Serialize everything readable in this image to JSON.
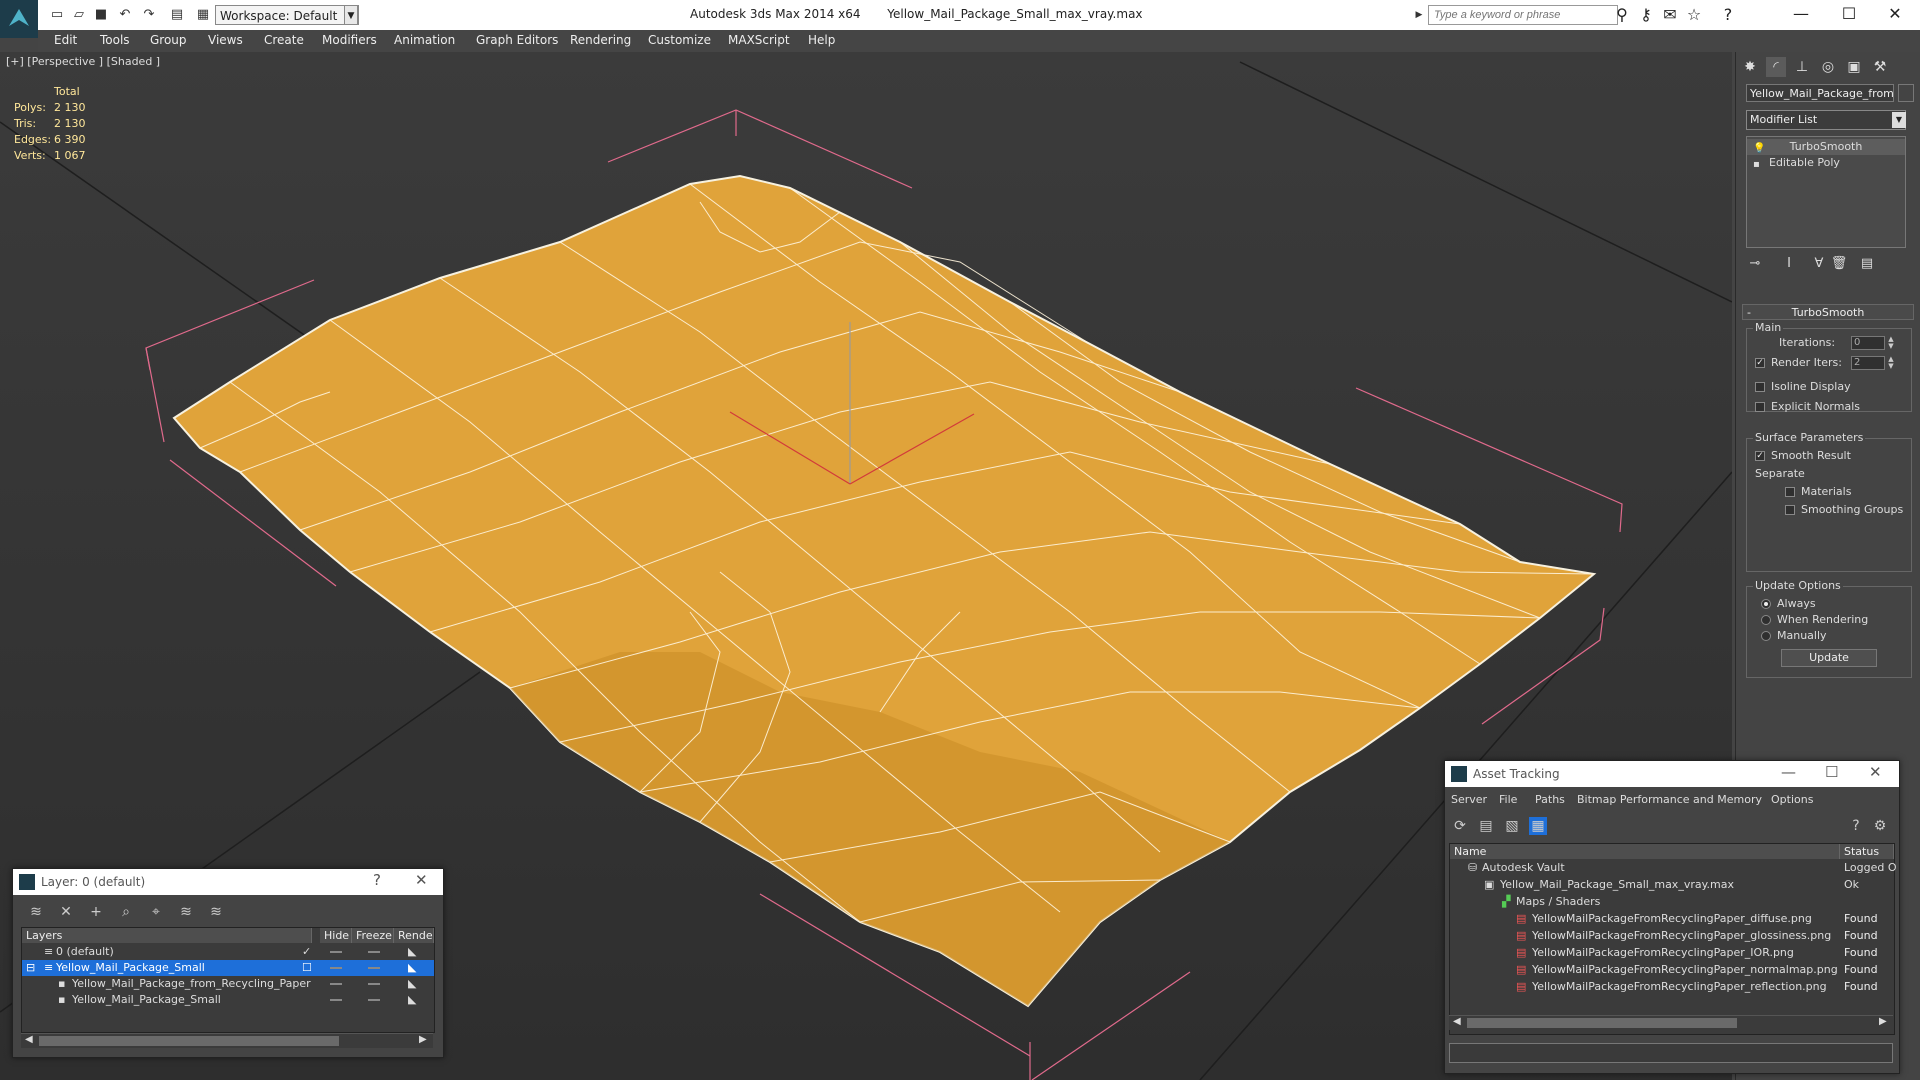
{
  "app": {
    "title": "Autodesk 3ds Max 2014 x64",
    "filename": "Yellow_Mail_Package_Small_max_vray.max",
    "workspace": "Workspace: Default",
    "search_placeholder": "Type a keyword or phrase"
  },
  "menu": [
    "Edit",
    "Tools",
    "Group",
    "Views",
    "Create",
    "Modifiers",
    "Animation",
    "Graph Editors",
    "Rendering",
    "Customize",
    "MAXScript",
    "Help"
  ],
  "viewport": {
    "label": "[+] [Perspective ] [Shaded ]",
    "stats": {
      "header": "Total",
      "rows": [
        {
          "label": "Polys:",
          "value": "2 130"
        },
        {
          "label": "Tris:",
          "value": "2 130"
        },
        {
          "label": "Edges:",
          "value": "6 390"
        },
        {
          "label": "Verts:",
          "value": "1 067"
        }
      ]
    },
    "colors": {
      "mesh": "#e0a33a",
      "wire": "#f5f0e0",
      "bbox": "#e06a8c"
    }
  },
  "command_panel": {
    "object_name": "Yellow_Mail_Package_from_R",
    "modifier_list": "Modifier List",
    "stack": [
      "TurboSmooth",
      "Editable Poly"
    ],
    "rollout": "TurboSmooth",
    "main_group": "Main",
    "iterations_label": "Iterations:",
    "iterations_value": "0",
    "render_iters_label": "Render Iters:",
    "render_iters_value": "2",
    "isoline": "Isoline Display",
    "explicit_normals": "Explicit Normals",
    "surface_group": "Surface Parameters",
    "smooth_result": "Smooth Result",
    "separate": "Separate",
    "materials": "Materials",
    "smoothing_groups": "Smoothing Groups",
    "update_group": "Update Options",
    "always": "Always",
    "when_rendering": "When Rendering",
    "manually": "Manually",
    "update_button": "Update"
  },
  "layer_panel": {
    "title": "Layer: 0 (default)",
    "help": "?",
    "columns": [
      "Layers",
      "Hide",
      "Freeze",
      "Render"
    ],
    "rows": [
      {
        "name": "0 (default)"
      },
      {
        "name": "Yellow_Mail_Package_Small"
      },
      {
        "name": "Yellow_Mail_Package_from_Recycling_Paper"
      },
      {
        "name": "Yellow_Mail_Package_Small"
      }
    ]
  },
  "asset_panel": {
    "title": "Asset Tracking",
    "menu": [
      "Server",
      "File",
      "Paths",
      "Bitmap Performance and Memory",
      "Options"
    ],
    "columns": [
      "Name",
      "Status"
    ],
    "rows": [
      {
        "name": "Autodesk Vault",
        "status": "Logged O"
      },
      {
        "name": "Yellow_Mail_Package_Small_max_vray.max",
        "status": "Ok"
      },
      {
        "name": "Maps / Shaders",
        "status": ""
      },
      {
        "name": "YellowMailPackageFromRecyclingPaper_diffuse.png",
        "status": "Found"
      },
      {
        "name": "YellowMailPackageFromRecyclingPaper_glossiness.png",
        "status": "Found"
      },
      {
        "name": "YellowMailPackageFromRecyclingPaper_IOR.png",
        "status": "Found"
      },
      {
        "name": "YellowMailPackageFromRecyclingPaper_normalmap.png",
        "status": "Found"
      },
      {
        "name": "YellowMailPackageFromRecyclingPaper_reflection.png",
        "status": "Found"
      }
    ]
  }
}
